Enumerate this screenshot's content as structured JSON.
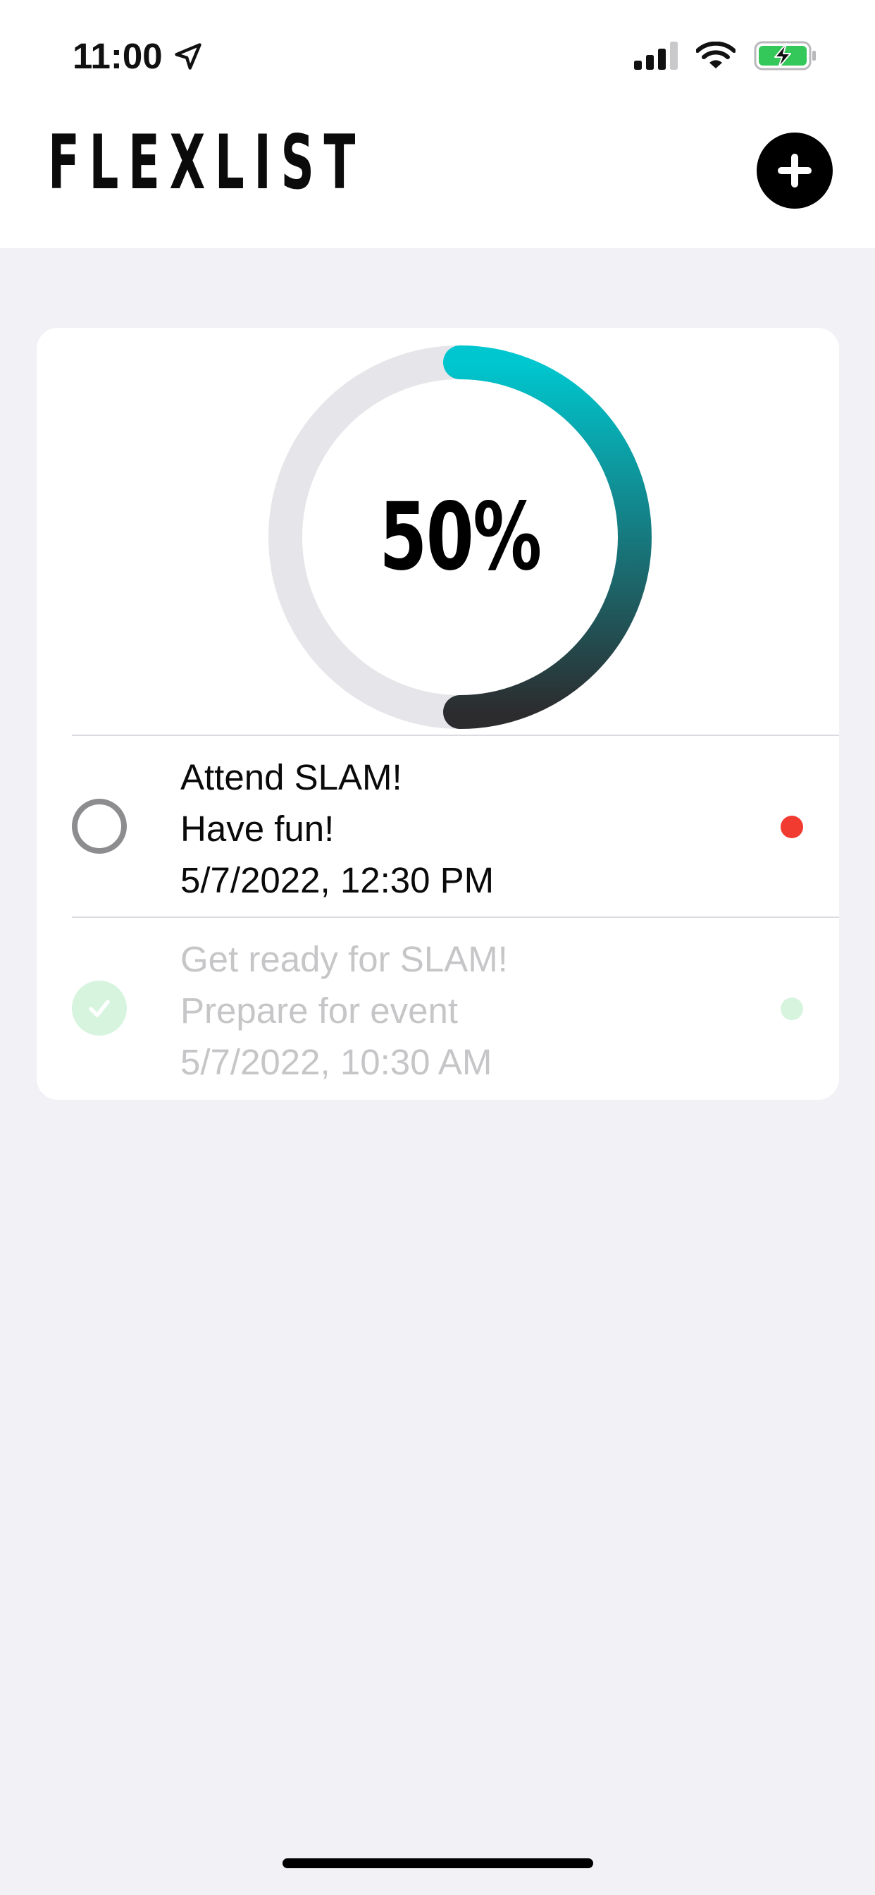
{
  "status_bar": {
    "time": "11:00",
    "location_icon": "location-arrow-icon",
    "signal_icon": "cellular-signal-icon",
    "wifi_icon": "wifi-icon",
    "battery_icon": "battery-charging-icon"
  },
  "header": {
    "title": "FLEXLIST",
    "add_icon": "plus-icon"
  },
  "progress": {
    "label": "50%",
    "value": 0.5,
    "colors": {
      "track": "#e6e6ea",
      "gradient_start": "#00c7cf",
      "gradient_end": "#2c2c2e"
    }
  },
  "tasks": [
    {
      "title": "Attend SLAM!",
      "note": "Have fun!",
      "datetime": "5/7/2022, 12:30 PM",
      "completed": false,
      "priority_color": "#f23b30"
    },
    {
      "title": "Get ready for SLAM!",
      "note": "Prepare for event",
      "datetime": "5/7/2022, 10:30 AM",
      "completed": true,
      "priority_color": "#d7f4df"
    }
  ]
}
